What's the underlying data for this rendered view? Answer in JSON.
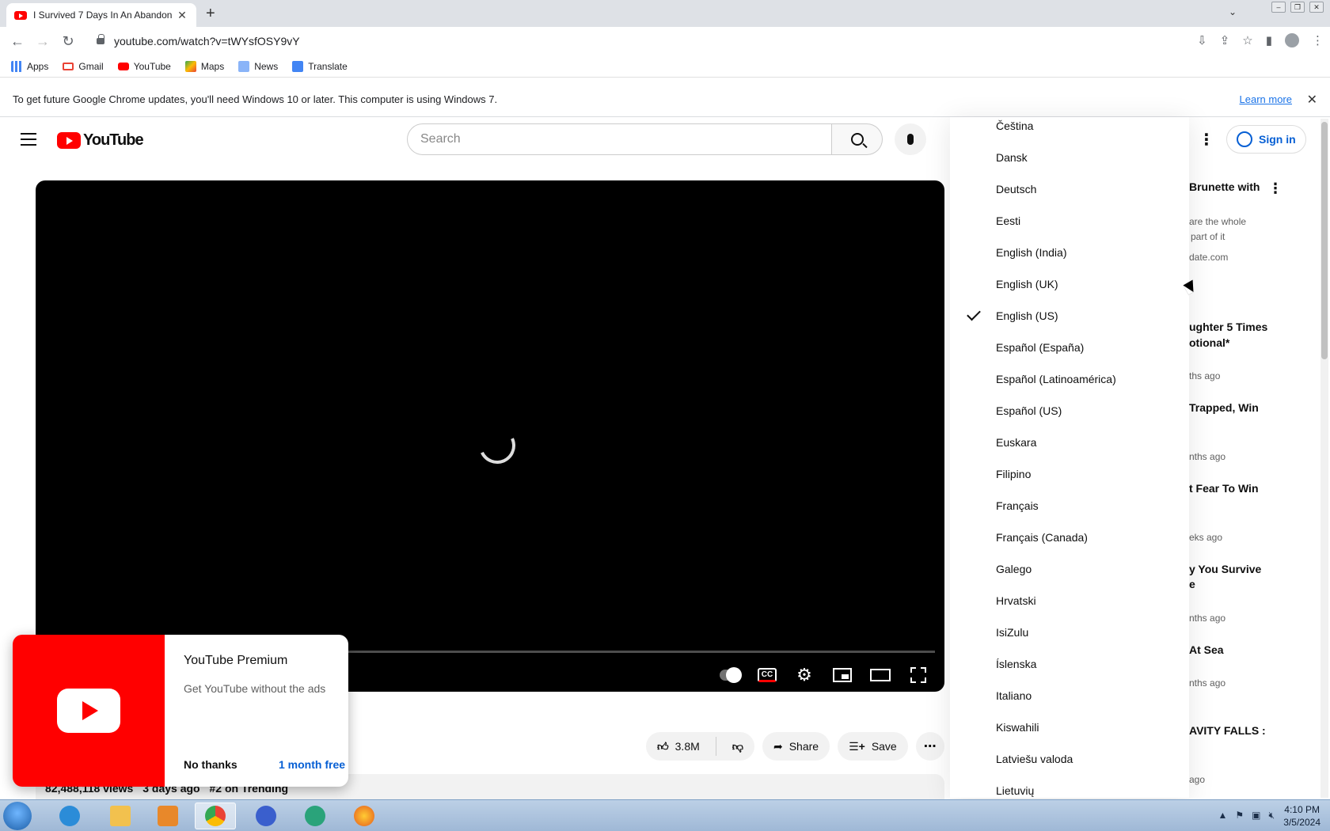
{
  "browser": {
    "tab_title": "I Survived 7 Days In An Abandon",
    "url": "youtube.com/watch?v=tWYsfOSY9vY",
    "bookmarks": [
      "Apps",
      "Gmail",
      "YouTube",
      "Maps",
      "News",
      "Translate"
    ],
    "infobar_text": "To get future Google Chrome updates, you'll need Windows 10 or later. This computer is using Windows 7.",
    "infobar_link": "Learn more"
  },
  "youtube": {
    "logo_text": "YouTube",
    "search_placeholder": "Search",
    "sign_in": "Sign in",
    "like_count": "3.8M",
    "share_label": "Share",
    "save_label": "Save",
    "views": "82,488,118 views",
    "age": "3 days ago",
    "trending": "#2 on Trending"
  },
  "premium_popup": {
    "title": "YouTube Premium",
    "subtitle": "Get YouTube without the ads",
    "dismiss": "No thanks",
    "cta": "1 month free"
  },
  "language_menu": {
    "selected": "English (US)",
    "items": [
      "Čeština",
      "Dansk",
      "Deutsch",
      "Eesti",
      "English (India)",
      "English (UK)",
      "English (US)",
      "Español (España)",
      "Español (Latinoamérica)",
      "Español (US)",
      "Euskara",
      "Filipino",
      "Français",
      "Français (Canada)",
      "Galego",
      "Hrvatski",
      "IsiZulu",
      "Íslenska",
      "Italiano",
      "Kiswahili",
      "Latviešu valoda",
      "Lietuvių"
    ]
  },
  "recommendations": [
    {
      "title": "Brunette with",
      "meta": [
        "are the whole",
        "part of it",
        "date.com"
      ]
    },
    {
      "title": "ughter 5 Times",
      "title2": "otional*",
      "meta": [
        "ths ago"
      ]
    },
    {
      "title": "Trapped, Win",
      "meta": [
        "nths ago"
      ]
    },
    {
      "title": "t Fear To Win",
      "meta": [
        "eks ago"
      ]
    },
    {
      "title": "y You Survive",
      "title2": "e",
      "meta": [
        "nths ago"
      ]
    },
    {
      "title": "At Sea",
      "meta": [
        "nths ago"
      ]
    },
    {
      "title": "AVITY FALLS :",
      "meta": [
        "ago"
      ]
    }
  ],
  "taskbar": {
    "time": "4:10 PM",
    "date": "3/5/2024"
  }
}
